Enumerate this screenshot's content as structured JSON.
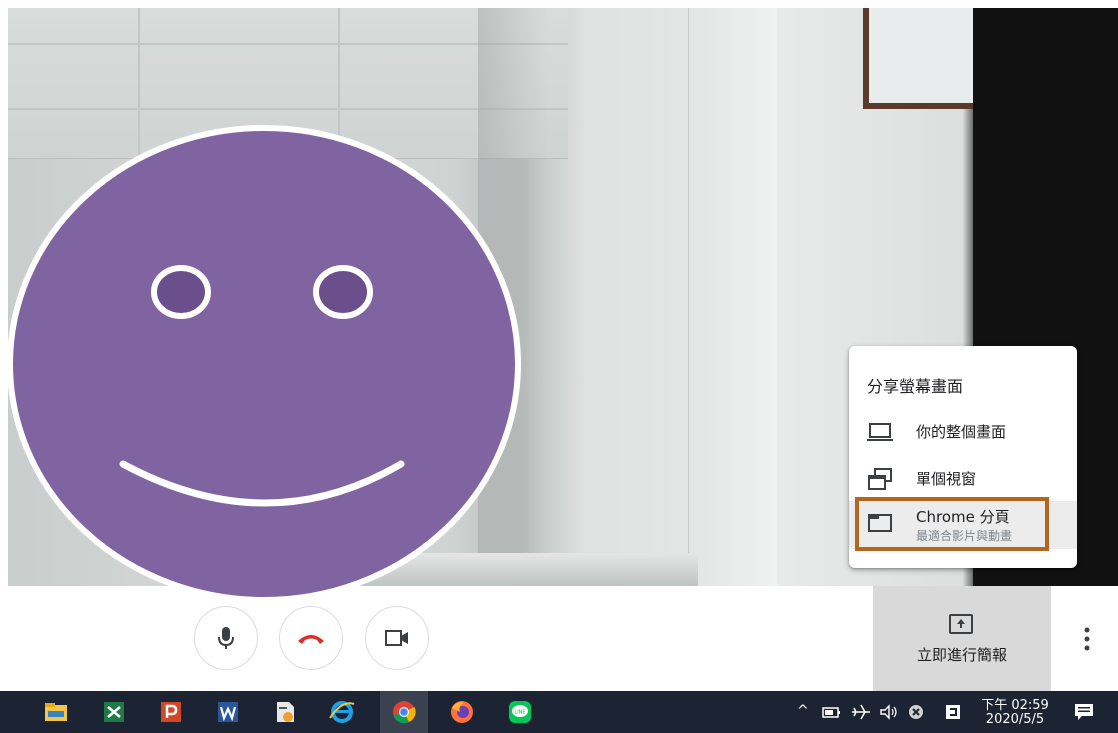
{
  "share_menu": {
    "title": "分享螢幕畫面",
    "items": [
      {
        "icon": "laptop-icon",
        "label": "你的整個畫面"
      },
      {
        "icon": "window-icon",
        "label": "單個視窗"
      },
      {
        "icon": "tab-icon",
        "label": "Chrome 分頁",
        "sublabel": "最適合影片與動畫"
      }
    ]
  },
  "controls": {
    "mic_icon": "mic-icon",
    "hangup_icon": "phone-hangup-icon",
    "camera_icon": "videocam-icon",
    "present_label": "立即進行簡報",
    "present_icon": "present-screen-icon",
    "more_icon": "more-vertical-icon"
  },
  "taskbar": {
    "apps": [
      "file-explorer-icon",
      "excel-icon",
      "powerpoint-icon",
      "word-icon",
      "pdf-tool-icon",
      "internet-explorer-icon",
      "chrome-icon",
      "firefox-icon",
      "line-icon"
    ],
    "tray_chevron": "^",
    "time": "下午 02:59",
    "date": "2020/5/5"
  },
  "colors": {
    "avatar_purple": "#8064a2",
    "avatar_eye": "#6b4f8c",
    "hangup_red": "#d93025",
    "highlight_orange": "#b5651d",
    "taskbar_bg": "#1c2433"
  }
}
